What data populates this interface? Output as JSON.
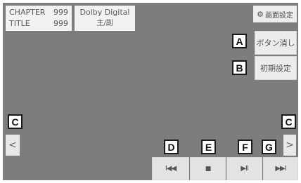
{
  "info": {
    "chapter_label": "CHAPTER",
    "chapter_value": "999",
    "title_label": "TITLE",
    "title_value": "999",
    "audio_format": "Dolby Digital",
    "audio_channel": "主/副"
  },
  "buttons": {
    "screen_settings": "画面設定",
    "hide_buttons": "ボタン消し",
    "initial_settings": "初期設定",
    "prev_symbol": "I◀◀",
    "stop_symbol": "■",
    "play_pause_symbol": "▶II",
    "next_symbol": "▶▶I",
    "left_arrow": "<",
    "right_arrow": ">"
  },
  "icons": {
    "screen_settings": "gear-icon"
  },
  "callouts": {
    "A": "A",
    "B": "B",
    "C_left": "C",
    "C_right": "C",
    "D": "D",
    "E": "E",
    "F": "F",
    "G": "G"
  }
}
